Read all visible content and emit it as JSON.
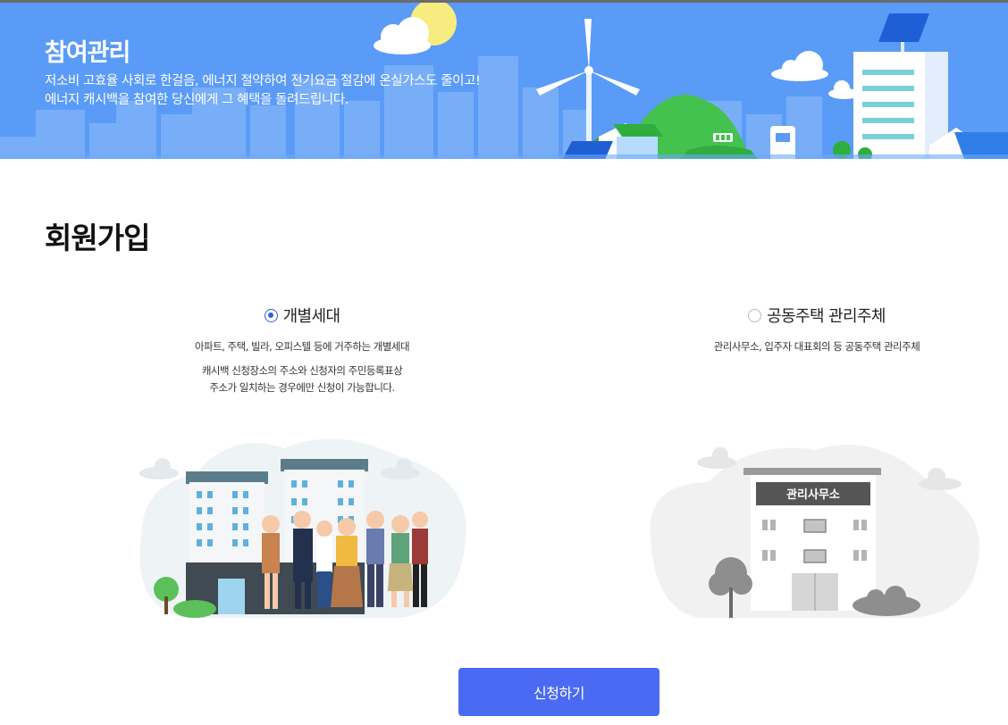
{
  "banner": {
    "title": "참여관리",
    "desc_line1": "저소비 고효율 사회로 한걸음, 에너지 절약하여 전기요금 절감에 온실가스도 줄이고!",
    "desc_line2": "에너지 캐시백을 참여한 당신에게 그 혜택을 돌려드립니다."
  },
  "page": {
    "title": "회원가입"
  },
  "options": [
    {
      "label": "개별세대",
      "selected": true,
      "desc": "아파트, 주택, 빌라, 오피스텔 등에 거주하는 개별세대",
      "note_line1": "캐시백 신청장소의 주소와 신청자의 주민등록표상",
      "note_line2": "주소가 일치하는 경우에만 신청이 가능합니다."
    },
    {
      "label": "공동주택 관리주체",
      "selected": false,
      "desc": "관리사무소, 입주자 대표회의 등 공동주택 관리주체"
    }
  ],
  "office_sign": "관리사무소",
  "submit": {
    "label": "신청하기"
  },
  "colors": {
    "banner": "#5a9bf7",
    "accent": "#4b6af3",
    "radio": "#2f62d6"
  }
}
